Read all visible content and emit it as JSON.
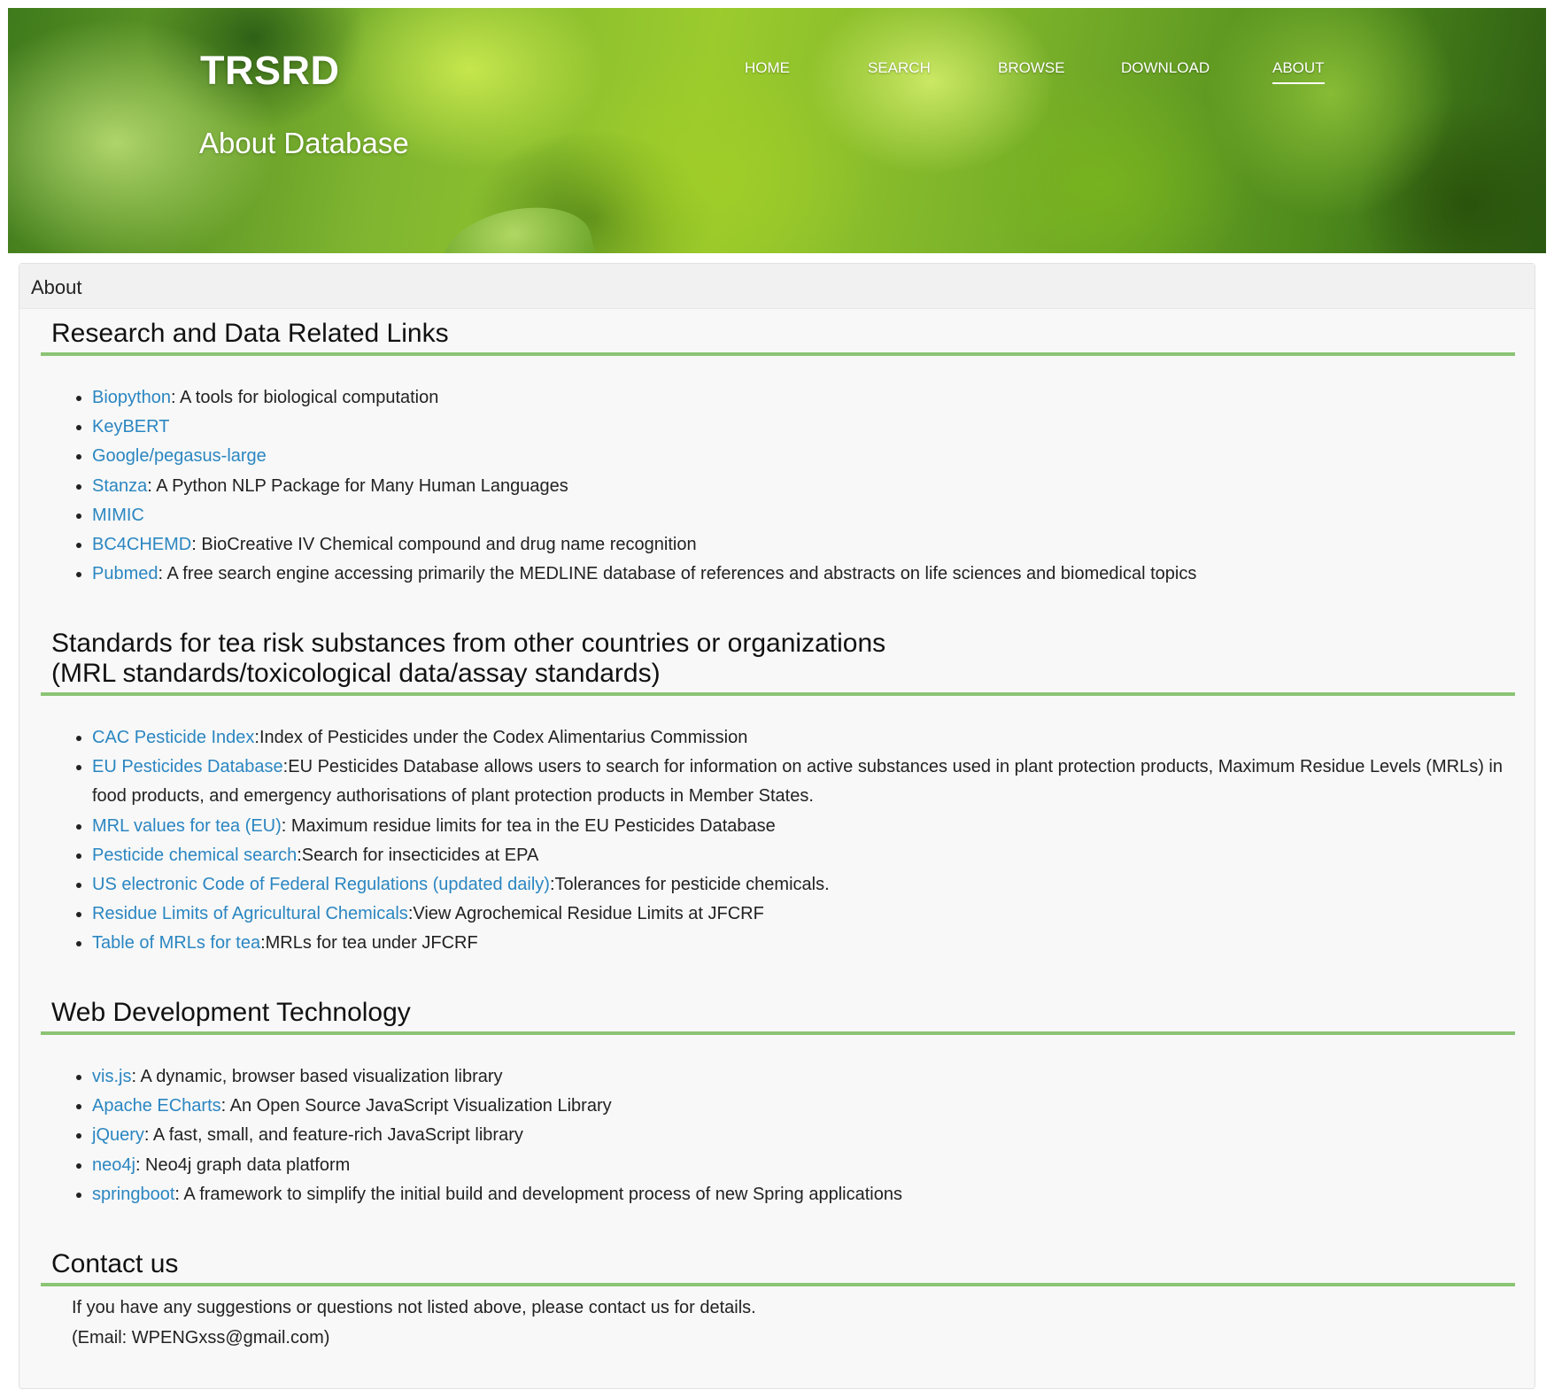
{
  "header": {
    "brand": "TRSRD",
    "page_heading": "About Database",
    "nav": [
      {
        "label": "HOME"
      },
      {
        "label": "SEARCH"
      },
      {
        "label": "BROWSE"
      },
      {
        "label": "DOWNLOAD"
      },
      {
        "label": "ABOUT",
        "active": true
      }
    ]
  },
  "panel": {
    "title": "About",
    "sections": {
      "research": {
        "heading": "Research and Data Related Links",
        "items": [
          {
            "link": "Biopython",
            "desc": ": A tools for biological computation"
          },
          {
            "link": "KeyBERT",
            "desc": ""
          },
          {
            "link": "Google/pegasus-large",
            "desc": ""
          },
          {
            "link": "Stanza",
            "desc": ": A Python NLP Package for Many Human Languages"
          },
          {
            "link": "MIMIC",
            "desc": ""
          },
          {
            "link": "BC4CHEMD",
            "desc": ": BioCreative IV Chemical compound and drug name recognition"
          },
          {
            "link": "Pubmed",
            "desc": ": A free search engine accessing primarily the MEDLINE database of references and abstracts on life sciences and biomedical topics"
          }
        ]
      },
      "standards": {
        "heading_line1": "Standards for tea risk substances from other countries or organizations",
        "heading_line2": "(MRL standards/toxicological data/assay standards)",
        "items": [
          {
            "link": "CAC Pesticide Index",
            "desc": ":Index of Pesticides under the Codex Alimentarius Commission"
          },
          {
            "link": "EU Pesticides Database",
            "desc": ":EU Pesticides Database allows users to search for information on active substances used in plant protection products, Maximum Residue Levels (MRLs) in food products, and emergency authorisations of plant protection products in Member States."
          },
          {
            "link": "MRL values for tea (EU)",
            "desc": ": Maximum residue limits for tea in the EU Pesticides Database"
          },
          {
            "link": "Pesticide chemical search",
            "desc": ":Search for insecticides at EPA"
          },
          {
            "link": "US electronic Code of Federal Regulations (updated daily)",
            "desc": ":Tolerances for pesticide chemicals."
          },
          {
            "link": "Residue Limits of Agricultural Chemicals",
            "desc": ":View Agrochemical Residue Limits at JFCRF"
          },
          {
            "link": "Table of MRLs for tea",
            "desc": ":MRLs for tea under JFCRF"
          }
        ]
      },
      "webdev": {
        "heading": "Web Development Technology",
        "items": [
          {
            "link": "vis.js",
            "desc": ": A dynamic, browser based visualization library"
          },
          {
            "link": "Apache ECharts",
            "desc": ": An Open Source JavaScript Visualization Library"
          },
          {
            "link": "jQuery",
            "desc": ": A fast, small, and feature-rich JavaScript library"
          },
          {
            "link": "neo4j",
            "desc": ": Neo4j graph data platform"
          },
          {
            "link": "springboot",
            "desc": ": A framework to simplify the initial build and development process of new Spring applications"
          }
        ]
      },
      "contact": {
        "heading": "Contact us",
        "line1": "If you have any suggestions or questions not listed above, please contact us for details.",
        "line2": "(Email: WPENGxss@gmail.com)"
      }
    }
  },
  "colors": {
    "link": "#2b86c1",
    "section_rule": "#8bc474",
    "panel_bg": "#f8f8f8"
  }
}
